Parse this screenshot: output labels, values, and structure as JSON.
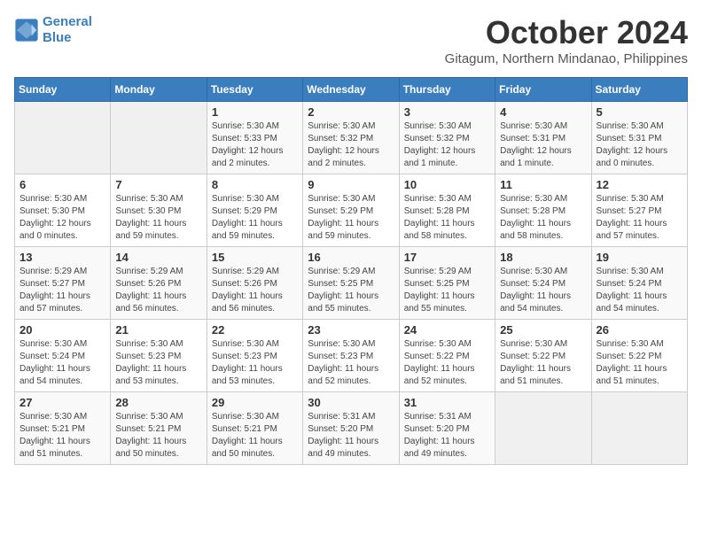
{
  "logo": {
    "line1": "General",
    "line2": "Blue"
  },
  "title": "October 2024",
  "location": "Gitagum, Northern Mindanao, Philippines",
  "weekdays": [
    "Sunday",
    "Monday",
    "Tuesday",
    "Wednesday",
    "Thursday",
    "Friday",
    "Saturday"
  ],
  "weeks": [
    [
      {
        "day": "",
        "info": ""
      },
      {
        "day": "",
        "info": ""
      },
      {
        "day": "1",
        "info": "Sunrise: 5:30 AM\nSunset: 5:33 PM\nDaylight: 12 hours\nand 2 minutes."
      },
      {
        "day": "2",
        "info": "Sunrise: 5:30 AM\nSunset: 5:32 PM\nDaylight: 12 hours\nand 2 minutes."
      },
      {
        "day": "3",
        "info": "Sunrise: 5:30 AM\nSunset: 5:32 PM\nDaylight: 12 hours\nand 1 minute."
      },
      {
        "day": "4",
        "info": "Sunrise: 5:30 AM\nSunset: 5:31 PM\nDaylight: 12 hours\nand 1 minute."
      },
      {
        "day": "5",
        "info": "Sunrise: 5:30 AM\nSunset: 5:31 PM\nDaylight: 12 hours\nand 0 minutes."
      }
    ],
    [
      {
        "day": "6",
        "info": "Sunrise: 5:30 AM\nSunset: 5:30 PM\nDaylight: 12 hours\nand 0 minutes."
      },
      {
        "day": "7",
        "info": "Sunrise: 5:30 AM\nSunset: 5:30 PM\nDaylight: 11 hours\nand 59 minutes."
      },
      {
        "day": "8",
        "info": "Sunrise: 5:30 AM\nSunset: 5:29 PM\nDaylight: 11 hours\nand 59 minutes."
      },
      {
        "day": "9",
        "info": "Sunrise: 5:30 AM\nSunset: 5:29 PM\nDaylight: 11 hours\nand 59 minutes."
      },
      {
        "day": "10",
        "info": "Sunrise: 5:30 AM\nSunset: 5:28 PM\nDaylight: 11 hours\nand 58 minutes."
      },
      {
        "day": "11",
        "info": "Sunrise: 5:30 AM\nSunset: 5:28 PM\nDaylight: 11 hours\nand 58 minutes."
      },
      {
        "day": "12",
        "info": "Sunrise: 5:30 AM\nSunset: 5:27 PM\nDaylight: 11 hours\nand 57 minutes."
      }
    ],
    [
      {
        "day": "13",
        "info": "Sunrise: 5:29 AM\nSunset: 5:27 PM\nDaylight: 11 hours\nand 57 minutes."
      },
      {
        "day": "14",
        "info": "Sunrise: 5:29 AM\nSunset: 5:26 PM\nDaylight: 11 hours\nand 56 minutes."
      },
      {
        "day": "15",
        "info": "Sunrise: 5:29 AM\nSunset: 5:26 PM\nDaylight: 11 hours\nand 56 minutes."
      },
      {
        "day": "16",
        "info": "Sunrise: 5:29 AM\nSunset: 5:25 PM\nDaylight: 11 hours\nand 55 minutes."
      },
      {
        "day": "17",
        "info": "Sunrise: 5:29 AM\nSunset: 5:25 PM\nDaylight: 11 hours\nand 55 minutes."
      },
      {
        "day": "18",
        "info": "Sunrise: 5:30 AM\nSunset: 5:24 PM\nDaylight: 11 hours\nand 54 minutes."
      },
      {
        "day": "19",
        "info": "Sunrise: 5:30 AM\nSunset: 5:24 PM\nDaylight: 11 hours\nand 54 minutes."
      }
    ],
    [
      {
        "day": "20",
        "info": "Sunrise: 5:30 AM\nSunset: 5:24 PM\nDaylight: 11 hours\nand 54 minutes."
      },
      {
        "day": "21",
        "info": "Sunrise: 5:30 AM\nSunset: 5:23 PM\nDaylight: 11 hours\nand 53 minutes."
      },
      {
        "day": "22",
        "info": "Sunrise: 5:30 AM\nSunset: 5:23 PM\nDaylight: 11 hours\nand 53 minutes."
      },
      {
        "day": "23",
        "info": "Sunrise: 5:30 AM\nSunset: 5:23 PM\nDaylight: 11 hours\nand 52 minutes."
      },
      {
        "day": "24",
        "info": "Sunrise: 5:30 AM\nSunset: 5:22 PM\nDaylight: 11 hours\nand 52 minutes."
      },
      {
        "day": "25",
        "info": "Sunrise: 5:30 AM\nSunset: 5:22 PM\nDaylight: 11 hours\nand 51 minutes."
      },
      {
        "day": "26",
        "info": "Sunrise: 5:30 AM\nSunset: 5:22 PM\nDaylight: 11 hours\nand 51 minutes."
      }
    ],
    [
      {
        "day": "27",
        "info": "Sunrise: 5:30 AM\nSunset: 5:21 PM\nDaylight: 11 hours\nand 51 minutes."
      },
      {
        "day": "28",
        "info": "Sunrise: 5:30 AM\nSunset: 5:21 PM\nDaylight: 11 hours\nand 50 minutes."
      },
      {
        "day": "29",
        "info": "Sunrise: 5:30 AM\nSunset: 5:21 PM\nDaylight: 11 hours\nand 50 minutes."
      },
      {
        "day": "30",
        "info": "Sunrise: 5:31 AM\nSunset: 5:20 PM\nDaylight: 11 hours\nand 49 minutes."
      },
      {
        "day": "31",
        "info": "Sunrise: 5:31 AM\nSunset: 5:20 PM\nDaylight: 11 hours\nand 49 minutes."
      },
      {
        "day": "",
        "info": ""
      },
      {
        "day": "",
        "info": ""
      }
    ]
  ]
}
